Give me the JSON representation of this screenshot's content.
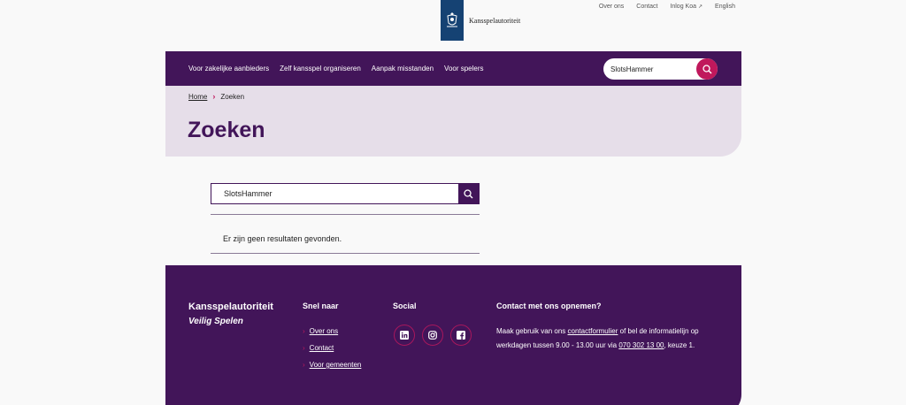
{
  "header": {
    "logo_text": "Kansspelautoriteit",
    "utility_links": [
      "Over ons",
      "Contact",
      "Inlog Koa",
      "English"
    ],
    "external_icon": "external-link-icon"
  },
  "nav": {
    "items": [
      "Voor zakelijke aanbieders",
      "Zelf kansspel organiseren",
      "Aanpak misstanden",
      "Voor spelers"
    ],
    "search_value": "SlotsHammer",
    "search_icon": "search-icon"
  },
  "hero": {
    "breadcrumb_home": "Home",
    "breadcrumb_current": "Zoeken",
    "title": "Zoeken"
  },
  "search": {
    "value": "SlotsHammer",
    "no_results": "Er zijn geen resultaten gevonden."
  },
  "footer": {
    "brand": "Kansspelautoriteit",
    "tagline": "Veilig Spelen",
    "quick_heading": "Snel naar",
    "quick_links": [
      "Over ons",
      "Contact",
      "Voor gemeenten"
    ],
    "social_heading": "Social",
    "social_icons": [
      "linkedin-icon",
      "instagram-icon",
      "facebook-icon"
    ],
    "contact_heading": "Contact met ons opnemen?",
    "contact_text_1": "Maak gebruik van ons ",
    "contact_link": "contactformulier",
    "contact_text_2": " of bel de informatielijn op werkdagen tussen 9.00 - 13.00 uur via ",
    "contact_phone": "070 302 13 00",
    "contact_text_3": ", keuze 1."
  },
  "colors": {
    "primary_purple": "#421559",
    "accent_pink": "#c0185c",
    "hero_bg": "#e6dee9",
    "logo_blue": "#154273"
  }
}
